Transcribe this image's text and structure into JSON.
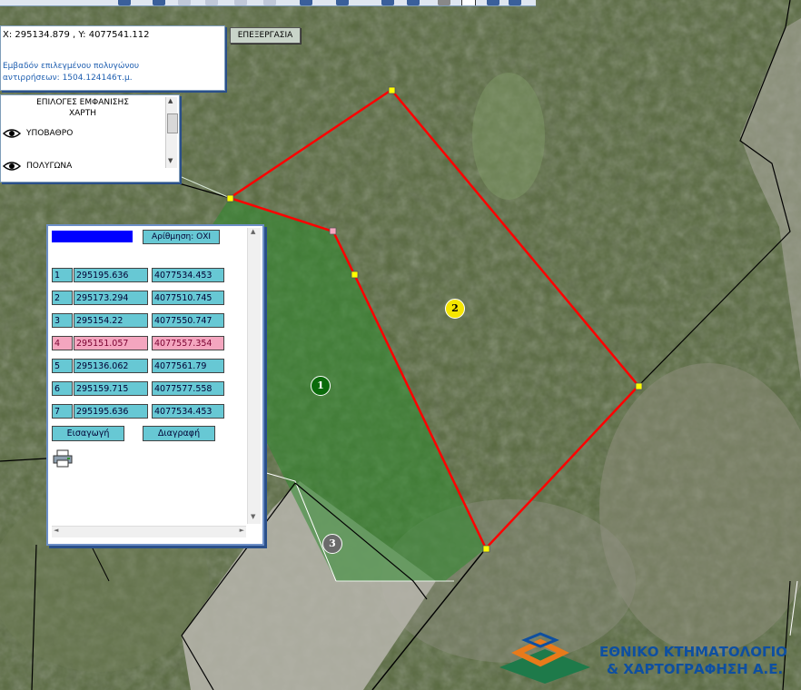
{
  "coords": {
    "text": "X: 295134.879 , Y: 4077541.112"
  },
  "area": {
    "line1": "Εμβαδόν επιλεγμένου πολυγώνου",
    "line2": "αντιρρήσεων: 1504.124146τ.μ."
  },
  "edit_button": "ΕΠΕΞΕΡΓΑΣΙΑ",
  "layers": {
    "title_line1": "ΕΠΙΛΟΓΕΣ ΕΜΦΑΝΙΣΗΣ",
    "title_line2": "ΧΑΡΤΗ",
    "items": [
      {
        "label": "ΥΠΟΒΑΘΡΟ",
        "icon": "eye-icon"
      },
      {
        "label": "ΠΟΛΥΓΩΝΑ",
        "icon": "eye-icon"
      }
    ]
  },
  "panel": {
    "polygon_color": "#0000ff",
    "numbering_button": "Αρίθμηση: ΟΧΙ",
    "rows": [
      {
        "idx": "1",
        "x": "295195.636",
        "y": "4077534.453",
        "selected": false
      },
      {
        "idx": "2",
        "x": "295173.294",
        "y": "4077510.745",
        "selected": false
      },
      {
        "idx": "3",
        "x": "295154.22",
        "y": "4077550.747",
        "selected": false
      },
      {
        "idx": "4",
        "x": "295151.057",
        "y": "4077557.354",
        "selected": true
      },
      {
        "idx": "5",
        "x": "295136.062",
        "y": "4077561.79",
        "selected": false
      },
      {
        "idx": "6",
        "x": "295159.715",
        "y": "4077577.558",
        "selected": false
      },
      {
        "idx": "7",
        "x": "295195.636",
        "y": "4077534.453",
        "selected": false
      }
    ],
    "insert_button": "Εισαγωγή",
    "delete_button": "Διαγραφή",
    "print_icon": "printer-icon"
  },
  "markers": [
    {
      "label": "1",
      "color": "#0b6b0b",
      "text_color": "#ffffff"
    },
    {
      "label": "2",
      "color": "#f5e600",
      "text_color": "#000000"
    },
    {
      "label": "3",
      "color": "#6b6b6b",
      "text_color": "#ffffff"
    }
  ],
  "logo": {
    "line1": "ΕΘΝΙΚΟ ΚΤΗΜΑΤΟΛΟΓΙΟ",
    "line2": "& ΧΑΡΤΟΓΡΑΦΗΣΗ Α.Ε."
  },
  "colors": {
    "selected_polygon_edge": "#ff0000",
    "parcel_fill": "#2e8b2e",
    "vertex": "#ffff00"
  }
}
